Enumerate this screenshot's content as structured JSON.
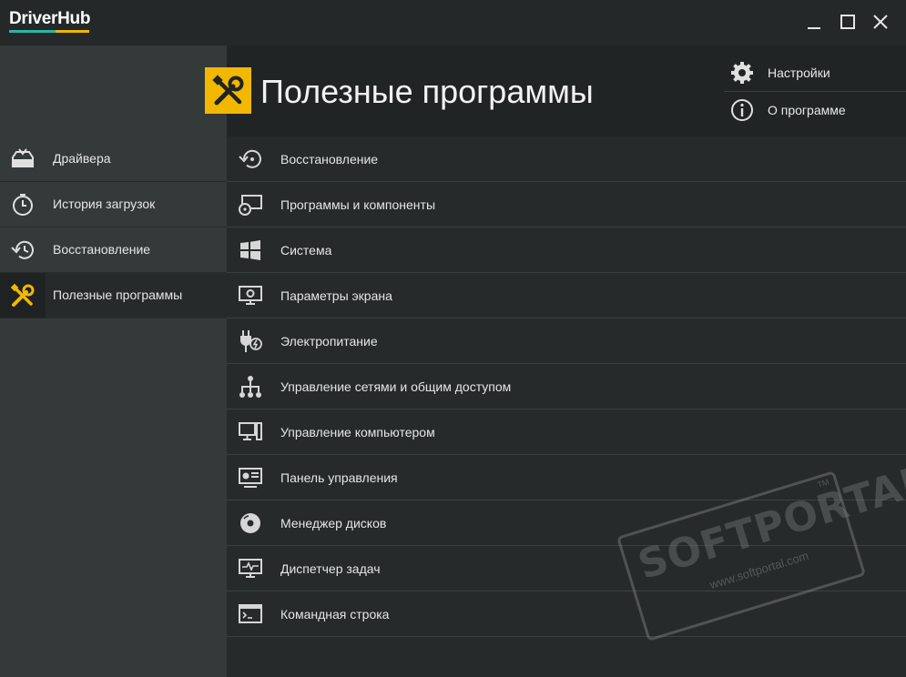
{
  "app": {
    "logo_text": "DriverHub",
    "window_controls": [
      "minimize-icon",
      "maximize-icon",
      "close-icon"
    ]
  },
  "sidebar": {
    "items": [
      {
        "label": "Драйвера",
        "icon": "driver-tray-icon",
        "active": false
      },
      {
        "label": "История загрузок",
        "icon": "clock-icon",
        "active": false
      },
      {
        "label": "Восстановление",
        "icon": "history-restore-icon",
        "active": false
      },
      {
        "label": "Полезные программы",
        "icon": "tools-icon",
        "active": true
      }
    ]
  },
  "header": {
    "title": "Полезные программы",
    "title_icon": "tools-icon",
    "links": [
      {
        "label": "Настройки",
        "icon": "gear-icon"
      },
      {
        "label": "О программе",
        "icon": "info-icon"
      }
    ]
  },
  "tools": [
    {
      "label": "Восстановление",
      "icon": "restore-icon"
    },
    {
      "label": "Программы и компоненты",
      "icon": "programs-disc-icon"
    },
    {
      "label": "Система",
      "icon": "windows-icon"
    },
    {
      "label": "Параметры экрана",
      "icon": "display-settings-icon"
    },
    {
      "label": "Электропитание",
      "icon": "power-plug-icon"
    },
    {
      "label": "Управление сетями и общим доступом",
      "icon": "network-icon"
    },
    {
      "label": "Управление компьютером",
      "icon": "computer-icon"
    },
    {
      "label": "Панель управления",
      "icon": "control-panel-icon"
    },
    {
      "label": "Менеджер дисков",
      "icon": "disk-icon"
    },
    {
      "label": "Диспетчер задач",
      "icon": "task-manager-icon"
    },
    {
      "label": "Командная строка",
      "icon": "command-prompt-icon"
    }
  ],
  "watermark": {
    "brand": "SOFTPORTAL",
    "url": "www.softportal.com",
    "tm": "TM"
  },
  "colors": {
    "accent": "#f2b800",
    "logo_teal": "#2bb5a5",
    "background": "#262a2a",
    "sidebar": "#343a3a"
  }
}
